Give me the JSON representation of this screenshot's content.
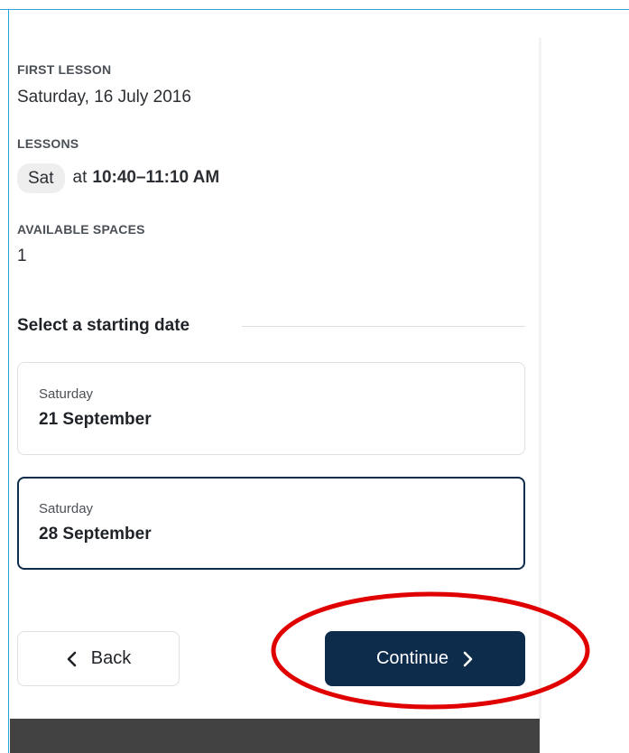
{
  "summary": {
    "first_lesson_label": "FIRST LESSON",
    "first_lesson_value": "Saturday, 16 July 2016",
    "lessons_label": "LESSONS",
    "lesson_day": "Sat",
    "lesson_at": "at",
    "lesson_time": "10:40–11:10 AM",
    "spaces_label": "AVAILABLE SPACES",
    "spaces_value": "1"
  },
  "start_dates": {
    "heading": "Select a starting date",
    "options": [
      {
        "day": "Saturday",
        "date": "21 September",
        "selected": false
      },
      {
        "day": "Saturday",
        "date": "28 September",
        "selected": true
      }
    ]
  },
  "actions": {
    "back_label": "Back",
    "continue_label": "Continue"
  },
  "icons": {
    "back": "chevron-left-icon",
    "continue": "chevron-right-icon"
  },
  "colors": {
    "primary": "#0d2b4a",
    "annotation": "#e00000",
    "footer": "#424242",
    "frame": "#29a3d9"
  }
}
